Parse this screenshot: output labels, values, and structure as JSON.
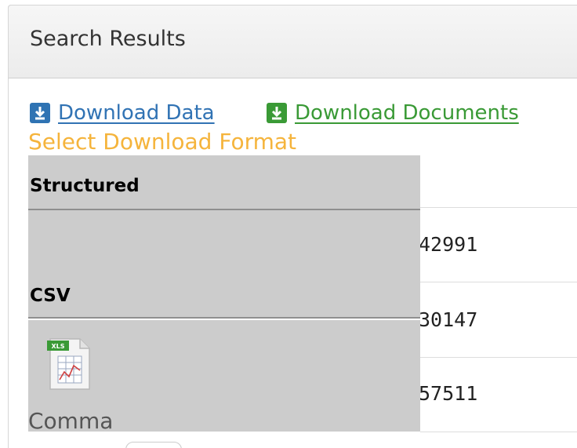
{
  "panel": {
    "title": "Search Results"
  },
  "downloads": {
    "data_label": "Download Data",
    "documents_label": "Download Documents",
    "data_icon": "download-icon",
    "documents_icon": "download-icon"
  },
  "format_menu": {
    "title": "Select Download Format",
    "sections": [
      {
        "label": "Structured"
      },
      {
        "label": "CSV"
      }
    ],
    "option": {
      "icon": "xls-file-icon",
      "label": "Comma"
    }
  },
  "results": {
    "values": [
      "42991",
      "30147",
      "57511"
    ]
  },
  "colors": {
    "link_blue": "#3173b4",
    "link_green": "#3a9a36",
    "format_title": "#f5b43c",
    "menu_background": "#cccccc"
  }
}
